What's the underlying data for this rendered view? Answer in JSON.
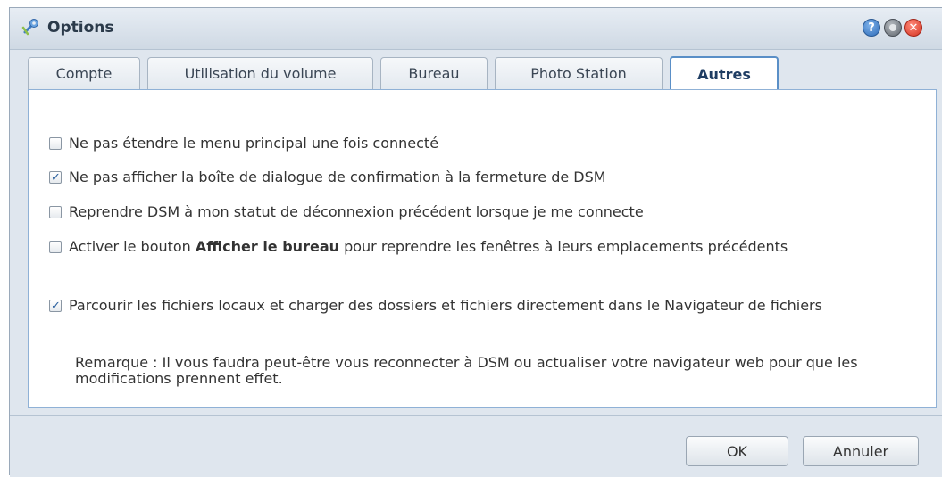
{
  "window": {
    "title": "Options"
  },
  "tabs": [
    {
      "label": "Compte",
      "active": false
    },
    {
      "label": "Utilisation du volume",
      "active": false
    },
    {
      "label": "Bureau",
      "active": false
    },
    {
      "label": "Photo Station",
      "active": false
    },
    {
      "label": "Autres",
      "active": true
    }
  ],
  "options": [
    {
      "label": "Ne pas étendre le menu principal une fois connecté",
      "checked": false
    },
    {
      "label": "Ne pas afficher la boîte de dialogue de confirmation à la fermeture de DSM",
      "checked": true
    },
    {
      "label": "Reprendre DSM à mon statut de déconnexion précédent lorsque je me connecte",
      "checked": false
    },
    {
      "label_pre": "Activer le bouton ",
      "label_bold": "Afficher le bureau",
      "label_post": " pour reprendre les fenêtres à leurs emplacements précédents",
      "checked": false
    },
    {
      "label": "Parcourir les fichiers locaux et charger des dossiers et fichiers directement dans le Navigateur de fichiers",
      "checked": true
    }
  ],
  "remark": "Remarque : Il vous faudra peut-être vous reconnecter à DSM ou actualiser votre navigateur web pour que les modifications prennent effet.",
  "buttons": {
    "ok": "OK",
    "cancel": "Annuler"
  },
  "colors": {
    "accent": "#5a8fc7",
    "close": "#d3311f",
    "help": "#2d6bb8"
  }
}
